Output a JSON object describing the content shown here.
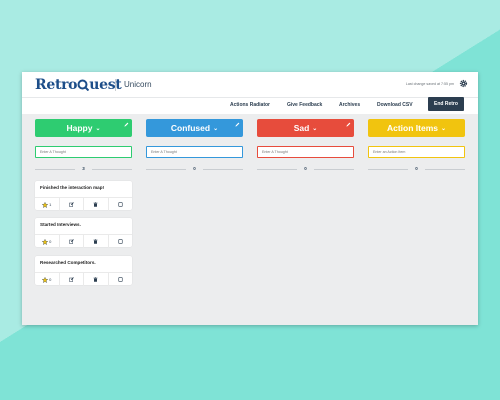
{
  "app": {
    "logo_text_left": "Retro",
    "logo_text_right": "uest",
    "team_name": "Unicorn",
    "last_change": "Last change saved at 7:55 pm"
  },
  "nav": {
    "actions_radiator": "Actions Radiator",
    "give_feedback": "Give Feedback",
    "archives": "Archives",
    "download_csv": "Download CSV",
    "end_retro": "End Retro"
  },
  "columns": [
    {
      "title": "Happy",
      "color": "#2ecc71",
      "placeholder": "Enter A Thought",
      "count": "3"
    },
    {
      "title": "Confused",
      "color": "#3498db",
      "placeholder": "Enter A Thought",
      "count": "0"
    },
    {
      "title": "Sad",
      "color": "#e74c3c",
      "placeholder": "Enter A Thought",
      "count": "0"
    },
    {
      "title": "Action Items",
      "color": "#f1c40f",
      "placeholder": "Enter an Action Item",
      "count": "0"
    }
  ],
  "cards": [
    {
      "text": "Finished the interaction map!",
      "stars": "1"
    },
    {
      "text": "Started Interviews.",
      "stars": "0"
    },
    {
      "text": "Researched Competitors.",
      "stars": "0"
    }
  ],
  "icons": {
    "logo": "magnifier-icon",
    "settings": "gear-icon",
    "edit_column": "pencil-icon",
    "star": "star-icon",
    "edit": "edit-icon",
    "delete": "trash-icon",
    "discussed": "checkbox-icon"
  }
}
